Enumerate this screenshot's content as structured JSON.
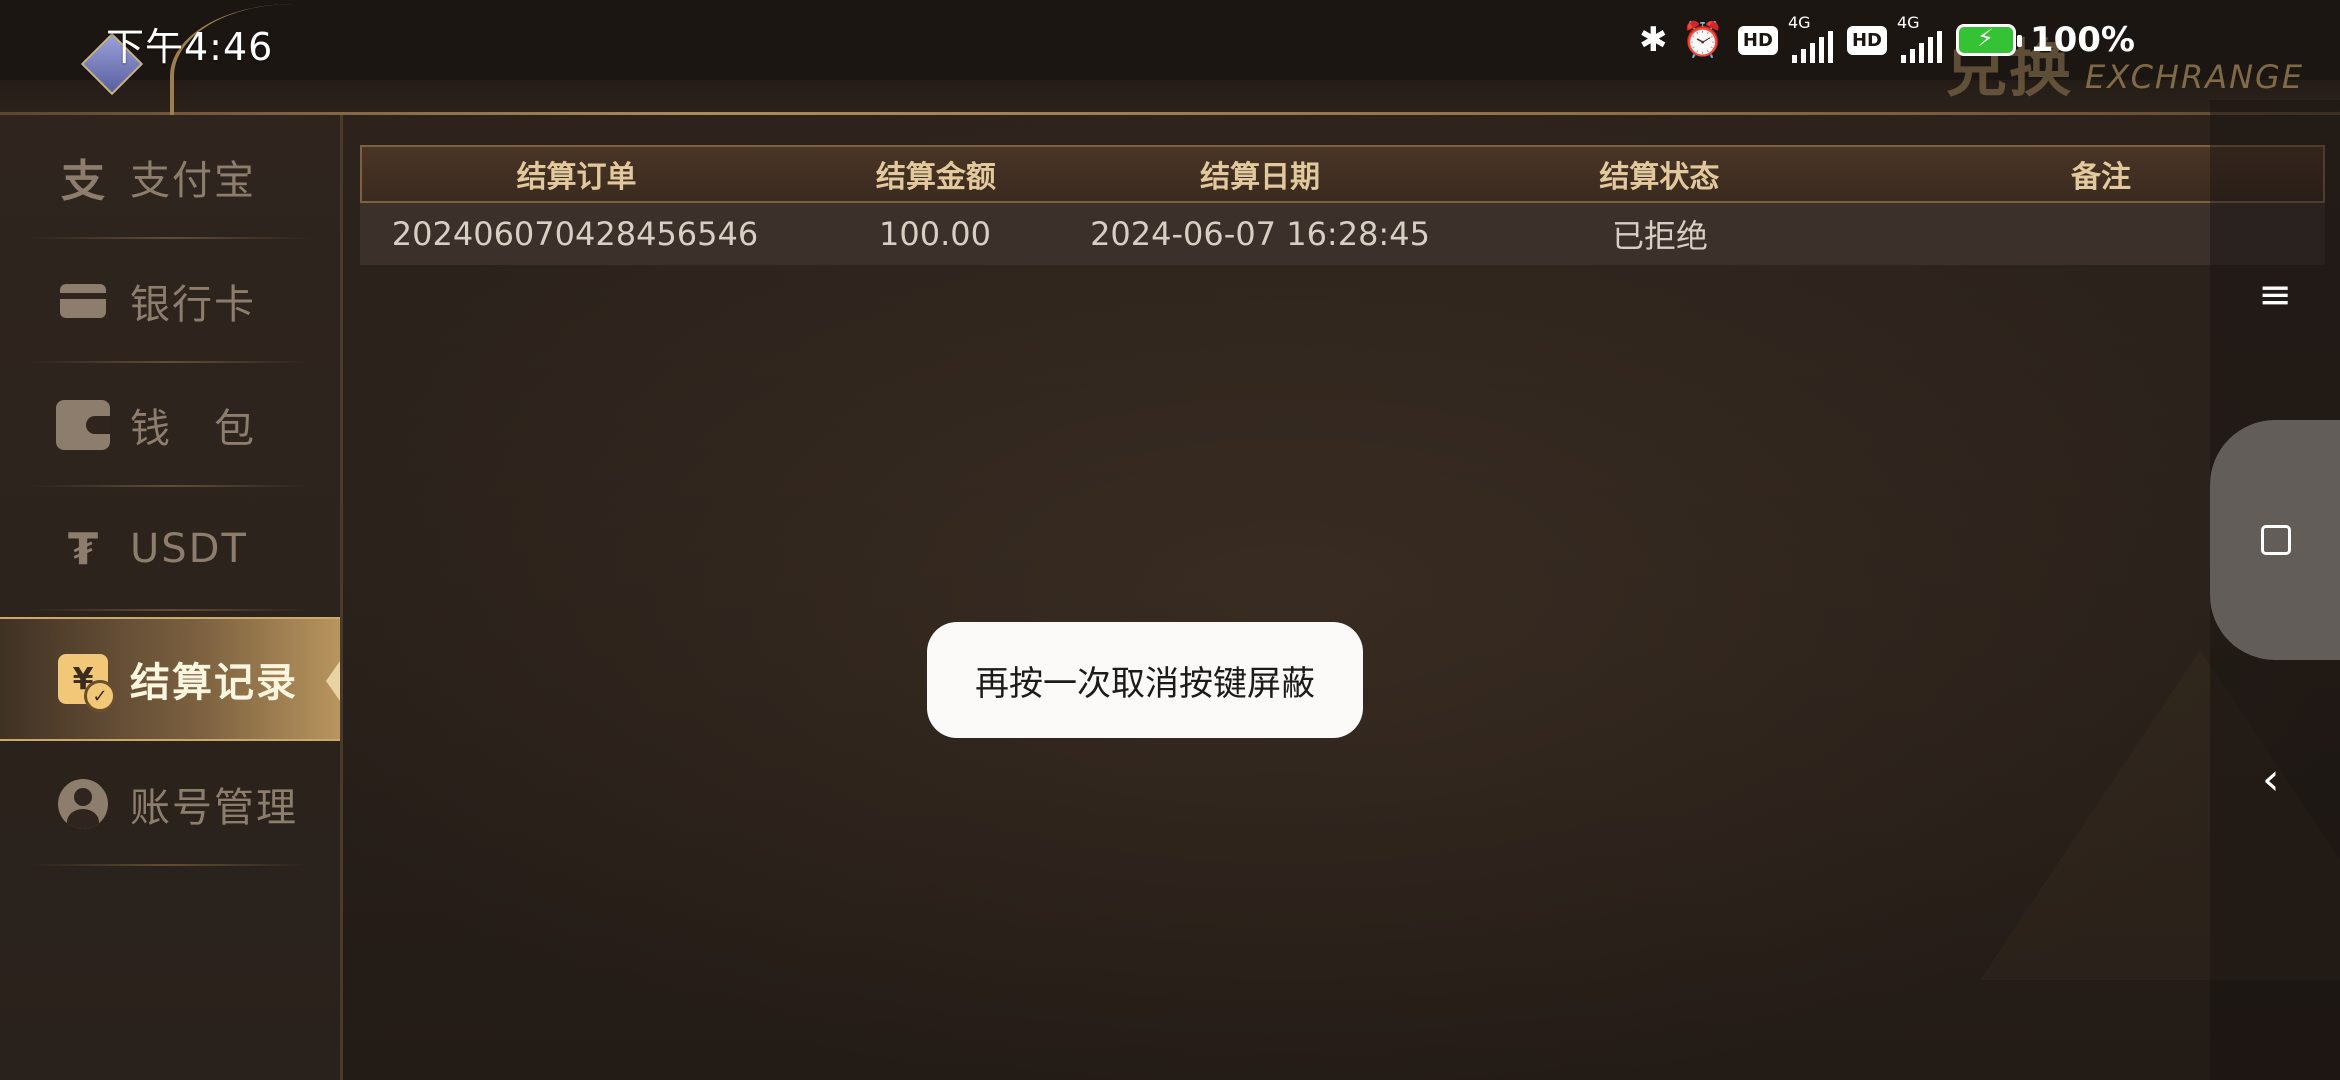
{
  "status_bar": {
    "time": "下午4:46",
    "battery": "100%",
    "network_1": "4G",
    "network_2": "4G",
    "hd_1": "HD",
    "hd_2": "HD"
  },
  "header": {
    "title_cn": "兑换",
    "title_en": "EXCHRANGE"
  },
  "sidebar": {
    "items": [
      {
        "label": "支付宝",
        "icon": "alipay-icon",
        "active": false
      },
      {
        "label": "银行卡",
        "icon": "bank-card-icon",
        "active": false
      },
      {
        "label": "钱　包",
        "icon": "wallet-icon",
        "active": false
      },
      {
        "label": "USDT",
        "icon": "usdt-icon",
        "active": false
      },
      {
        "label": "结算记录",
        "icon": "settlement-record-icon",
        "active": true
      },
      {
        "label": "账号管理",
        "icon": "account-icon",
        "active": false
      }
    ]
  },
  "table": {
    "headers": [
      "结算订单",
      "结算金额",
      "结算日期",
      "结算状态",
      "备注"
    ],
    "rows": [
      [
        "202406070428456546",
        "100.00",
        "2024-06-07 16:28:45",
        "已拒绝",
        ""
      ]
    ]
  },
  "toast": {
    "message": "再按一次取消按键屏蔽"
  },
  "colors": {
    "accent_gold": "#c9a96c",
    "background": "#2a211b",
    "battery_green": "#35c235"
  }
}
